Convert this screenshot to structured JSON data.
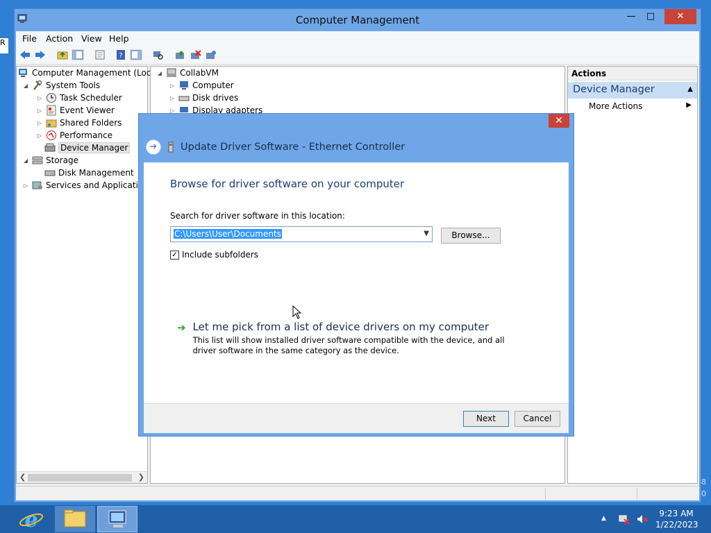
{
  "window": {
    "title": "Computer Management"
  },
  "menu": [
    "File",
    "Action",
    "View",
    "Help"
  ],
  "tree_left": [
    {
      "label": "Computer Management (Local",
      "level": 0,
      "expander": "",
      "icon": "computer-management-icon"
    },
    {
      "label": "System Tools",
      "level": 1,
      "expander": "◢",
      "icon": "system-tools-icon"
    },
    {
      "label": "Task Scheduler",
      "level": 2,
      "expander": "▷",
      "icon": "clock-icon"
    },
    {
      "label": "Event Viewer",
      "level": 2,
      "expander": "▷",
      "icon": "event-viewer-icon"
    },
    {
      "label": "Shared Folders",
      "level": 2,
      "expander": "▷",
      "icon": "shared-folders-icon"
    },
    {
      "label": "Performance",
      "level": 2,
      "expander": "▷",
      "icon": "performance-icon"
    },
    {
      "label": "Device Manager",
      "level": 2,
      "expander": "",
      "icon": "device-manager-icon",
      "selected": true
    },
    {
      "label": "Storage",
      "level": 1,
      "expander": "◢",
      "icon": "storage-icon"
    },
    {
      "label": "Disk Management",
      "level": 2,
      "expander": "",
      "icon": "disk-icon"
    },
    {
      "label": "Services and Applications",
      "level": 1,
      "expander": "▷",
      "icon": "services-icon"
    }
  ],
  "tree_mid": [
    {
      "label": "CollabVM",
      "level": 0,
      "expander": "◢",
      "icon": "computer-icon"
    },
    {
      "label": "Computer",
      "level": 1,
      "expander": "▷",
      "icon": "monitor-icon"
    },
    {
      "label": "Disk drives",
      "level": 1,
      "expander": "▷",
      "icon": "disk-drive-icon"
    },
    {
      "label": "Display adapters",
      "level": 1,
      "expander": "▷",
      "icon": "display-adapter-icon"
    }
  ],
  "actions": {
    "header": "Actions",
    "selected": "Device Manager",
    "more": "More Actions"
  },
  "dialog": {
    "title": "Update Driver Software - Ethernet Controller",
    "heading": "Browse for driver software on your computer",
    "search_label": "Search for driver software in this location:",
    "path_value": "C:\\Users\\User\\Documents",
    "browse_label": "Browse...",
    "include_subfolders_label": "Include subfolders",
    "include_subfolders_checked": true,
    "pick_title": "Let me pick from a list of device drivers on my computer",
    "pick_desc": "This list will show installed driver software compatible with the device, and all driver software in the same category as the device.",
    "next_label": "Next",
    "cancel_label": "Cancel",
    "close_glyph": "✕"
  },
  "taskbar": {
    "time": "9:23 AM",
    "date": "1/22/2023"
  },
  "desktop_edge_text": "8\n0",
  "desktop_left_char": "R"
}
